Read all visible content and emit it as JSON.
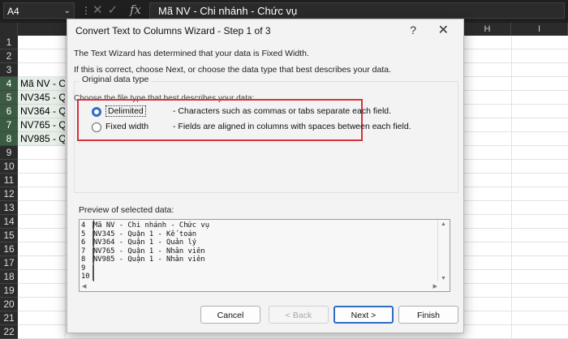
{
  "excel": {
    "name_box": "A4",
    "fx_label": "fx",
    "formula_value": "Mã NV - Chi nhánh - Chức vụ",
    "columns": [
      "",
      "H",
      "I"
    ],
    "rows": [
      "1",
      "2",
      "3",
      "4",
      "5",
      "6",
      "7",
      "8",
      "9",
      "10",
      "11",
      "12",
      "13",
      "14",
      "15",
      "16",
      "17",
      "18",
      "19",
      "20",
      "21",
      "22"
    ],
    "cells": [
      "Mã NV - Ch",
      "NV345 - Qu",
      "NV364 - Qu",
      "NV765 - Qu",
      "NV985 - Qu"
    ]
  },
  "dialog": {
    "title": "Convert Text to Columns Wizard - Step 1 of 3",
    "help": "?",
    "close": "✕",
    "intro_line1": "The Text Wizard has determined that your data is Fixed Width.",
    "intro_line2": "If this is correct, choose Next, or choose the data type that best describes your data.",
    "group_title": "Original data type",
    "choose_label": "Choose the file type that best describes your data:",
    "options": [
      {
        "label": "Delimited",
        "description": "- Characters such as commas or tabs separate each field.",
        "selected": true
      },
      {
        "label": "Fixed width",
        "description": "- Fields are aligned in columns with spaces between each field.",
        "selected": false
      }
    ],
    "preview_title": "Preview of selected data:",
    "preview_rows": [
      {
        "n": "4",
        "text": "Mã NV - Chi nhánh - Chức vụ"
      },
      {
        "n": "5",
        "text": "NV345 - Quận 1 - Kế toán"
      },
      {
        "n": "6",
        "text": "NV364 - Quận 1 - Quản lý"
      },
      {
        "n": "7",
        "text": "NV765 - Quận 1 - Nhân viên"
      },
      {
        "n": "8",
        "text": "NV985 - Quận 1 - Nhân viên"
      },
      {
        "n": "9",
        "text": ""
      },
      {
        "n": "10",
        "text": ""
      }
    ],
    "buttons": {
      "cancel": "Cancel",
      "back": "< Back",
      "next": "Next >",
      "finish": "Finish"
    }
  },
  "colors": {
    "accent": "#2e6cc6",
    "highlight": "#d9303b",
    "selection": "#3a5c43"
  }
}
